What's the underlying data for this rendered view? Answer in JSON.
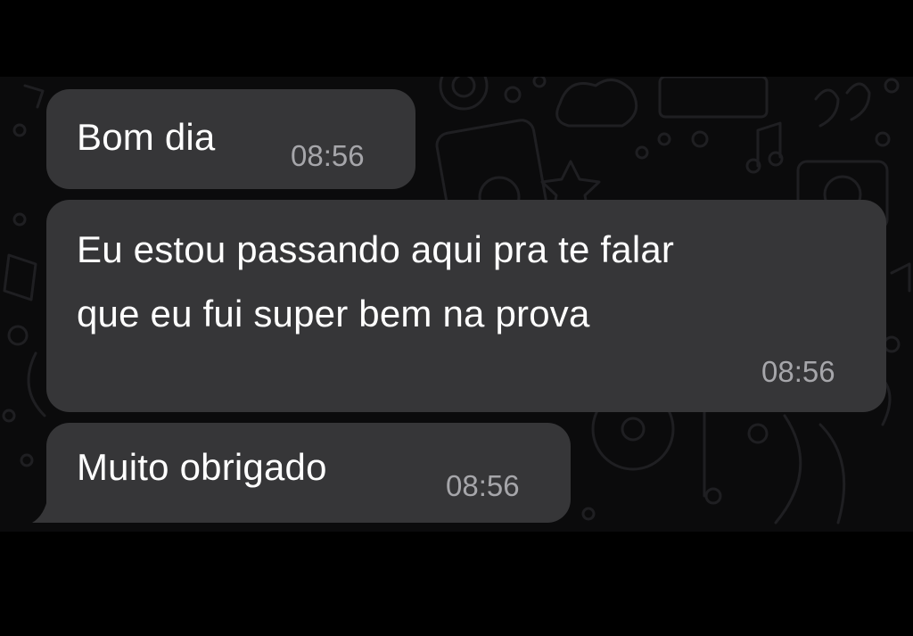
{
  "theme": {
    "bubble_color": "#363638",
    "background_color": "#0b0b0c",
    "text_color": "#ffffff",
    "timestamp_color": "#a6a6aa"
  },
  "messages": [
    {
      "lines": [
        "Bom dia"
      ],
      "time": "08:56",
      "direction": "incoming"
    },
    {
      "lines": [
        "Eu estou passando aqui pra te falar",
        "que eu fui super bem na prova"
      ],
      "time": "08:56",
      "direction": "incoming"
    },
    {
      "lines": [
        "Muito obrigado"
      ],
      "time": "08:56",
      "direction": "incoming"
    }
  ]
}
